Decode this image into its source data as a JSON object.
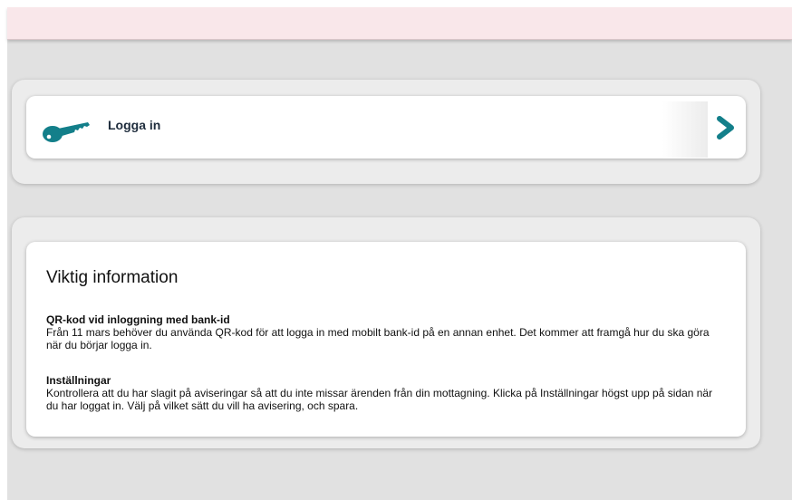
{
  "login": {
    "label": "Logga in",
    "icons": {
      "leading": "key-icon",
      "trailing": "chevron-right-icon"
    },
    "accent_color": "#137f8a"
  },
  "info": {
    "title": "Viktig information",
    "sections": [
      {
        "heading": "QR-kod vid inloggning med bank-id",
        "body": "Från 11 mars behöver du använda QR-kod för att logga in med mobilt bank-id på en annan enhet. Det kommer att framgå hur du ska göra när du börjar logga in."
      },
      {
        "heading": "Inställningar",
        "body": "Kontrollera att du har slagit på aviseringar så att du inte missar ärenden från din mottagning. Klicka på Inställningar högst upp på sidan när du har loggat in. Välj på vilket sätt du vill ha avisering, och spara."
      }
    ]
  },
  "colors": {
    "topbar": "#f9e7ea",
    "background": "#e1e1e1",
    "panel": "#ececec",
    "card": "#ffffff"
  }
}
